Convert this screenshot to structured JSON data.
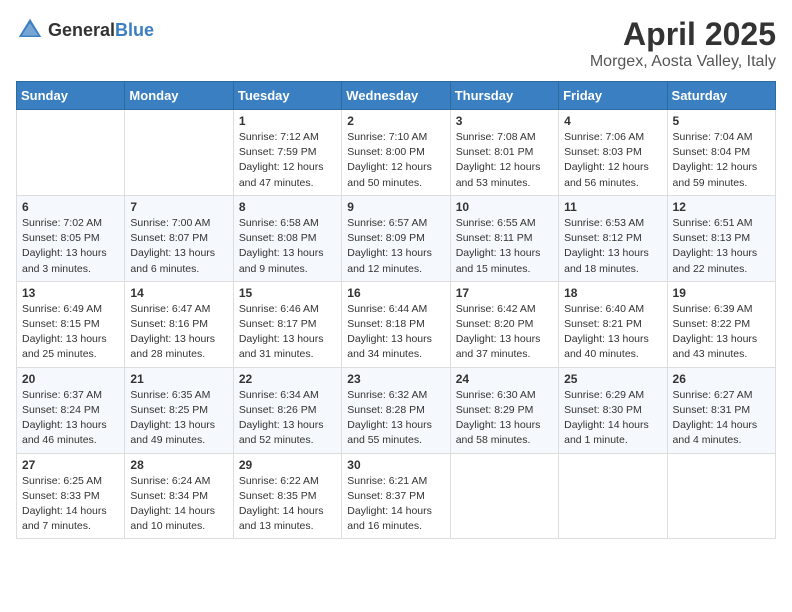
{
  "header": {
    "logo_general": "General",
    "logo_blue": "Blue",
    "month_title": "April 2025",
    "location": "Morgex, Aosta Valley, Italy"
  },
  "weekdays": [
    "Sunday",
    "Monday",
    "Tuesday",
    "Wednesday",
    "Thursday",
    "Friday",
    "Saturday"
  ],
  "weeks": [
    [
      {
        "day": "",
        "info": ""
      },
      {
        "day": "",
        "info": ""
      },
      {
        "day": "1",
        "info": "Sunrise: 7:12 AM\nSunset: 7:59 PM\nDaylight: 12 hours and 47 minutes."
      },
      {
        "day": "2",
        "info": "Sunrise: 7:10 AM\nSunset: 8:00 PM\nDaylight: 12 hours and 50 minutes."
      },
      {
        "day": "3",
        "info": "Sunrise: 7:08 AM\nSunset: 8:01 PM\nDaylight: 12 hours and 53 minutes."
      },
      {
        "day": "4",
        "info": "Sunrise: 7:06 AM\nSunset: 8:03 PM\nDaylight: 12 hours and 56 minutes."
      },
      {
        "day": "5",
        "info": "Sunrise: 7:04 AM\nSunset: 8:04 PM\nDaylight: 12 hours and 59 minutes."
      }
    ],
    [
      {
        "day": "6",
        "info": "Sunrise: 7:02 AM\nSunset: 8:05 PM\nDaylight: 13 hours and 3 minutes."
      },
      {
        "day": "7",
        "info": "Sunrise: 7:00 AM\nSunset: 8:07 PM\nDaylight: 13 hours and 6 minutes."
      },
      {
        "day": "8",
        "info": "Sunrise: 6:58 AM\nSunset: 8:08 PM\nDaylight: 13 hours and 9 minutes."
      },
      {
        "day": "9",
        "info": "Sunrise: 6:57 AM\nSunset: 8:09 PM\nDaylight: 13 hours and 12 minutes."
      },
      {
        "day": "10",
        "info": "Sunrise: 6:55 AM\nSunset: 8:11 PM\nDaylight: 13 hours and 15 minutes."
      },
      {
        "day": "11",
        "info": "Sunrise: 6:53 AM\nSunset: 8:12 PM\nDaylight: 13 hours and 18 minutes."
      },
      {
        "day": "12",
        "info": "Sunrise: 6:51 AM\nSunset: 8:13 PM\nDaylight: 13 hours and 22 minutes."
      }
    ],
    [
      {
        "day": "13",
        "info": "Sunrise: 6:49 AM\nSunset: 8:15 PM\nDaylight: 13 hours and 25 minutes."
      },
      {
        "day": "14",
        "info": "Sunrise: 6:47 AM\nSunset: 8:16 PM\nDaylight: 13 hours and 28 minutes."
      },
      {
        "day": "15",
        "info": "Sunrise: 6:46 AM\nSunset: 8:17 PM\nDaylight: 13 hours and 31 minutes."
      },
      {
        "day": "16",
        "info": "Sunrise: 6:44 AM\nSunset: 8:18 PM\nDaylight: 13 hours and 34 minutes."
      },
      {
        "day": "17",
        "info": "Sunrise: 6:42 AM\nSunset: 8:20 PM\nDaylight: 13 hours and 37 minutes."
      },
      {
        "day": "18",
        "info": "Sunrise: 6:40 AM\nSunset: 8:21 PM\nDaylight: 13 hours and 40 minutes."
      },
      {
        "day": "19",
        "info": "Sunrise: 6:39 AM\nSunset: 8:22 PM\nDaylight: 13 hours and 43 minutes."
      }
    ],
    [
      {
        "day": "20",
        "info": "Sunrise: 6:37 AM\nSunset: 8:24 PM\nDaylight: 13 hours and 46 minutes."
      },
      {
        "day": "21",
        "info": "Sunrise: 6:35 AM\nSunset: 8:25 PM\nDaylight: 13 hours and 49 minutes."
      },
      {
        "day": "22",
        "info": "Sunrise: 6:34 AM\nSunset: 8:26 PM\nDaylight: 13 hours and 52 minutes."
      },
      {
        "day": "23",
        "info": "Sunrise: 6:32 AM\nSunset: 8:28 PM\nDaylight: 13 hours and 55 minutes."
      },
      {
        "day": "24",
        "info": "Sunrise: 6:30 AM\nSunset: 8:29 PM\nDaylight: 13 hours and 58 minutes."
      },
      {
        "day": "25",
        "info": "Sunrise: 6:29 AM\nSunset: 8:30 PM\nDaylight: 14 hours and 1 minute."
      },
      {
        "day": "26",
        "info": "Sunrise: 6:27 AM\nSunset: 8:31 PM\nDaylight: 14 hours and 4 minutes."
      }
    ],
    [
      {
        "day": "27",
        "info": "Sunrise: 6:25 AM\nSunset: 8:33 PM\nDaylight: 14 hours and 7 minutes."
      },
      {
        "day": "28",
        "info": "Sunrise: 6:24 AM\nSunset: 8:34 PM\nDaylight: 14 hours and 10 minutes."
      },
      {
        "day": "29",
        "info": "Sunrise: 6:22 AM\nSunset: 8:35 PM\nDaylight: 14 hours and 13 minutes."
      },
      {
        "day": "30",
        "info": "Sunrise: 6:21 AM\nSunset: 8:37 PM\nDaylight: 14 hours and 16 minutes."
      },
      {
        "day": "",
        "info": ""
      },
      {
        "day": "",
        "info": ""
      },
      {
        "day": "",
        "info": ""
      }
    ]
  ]
}
